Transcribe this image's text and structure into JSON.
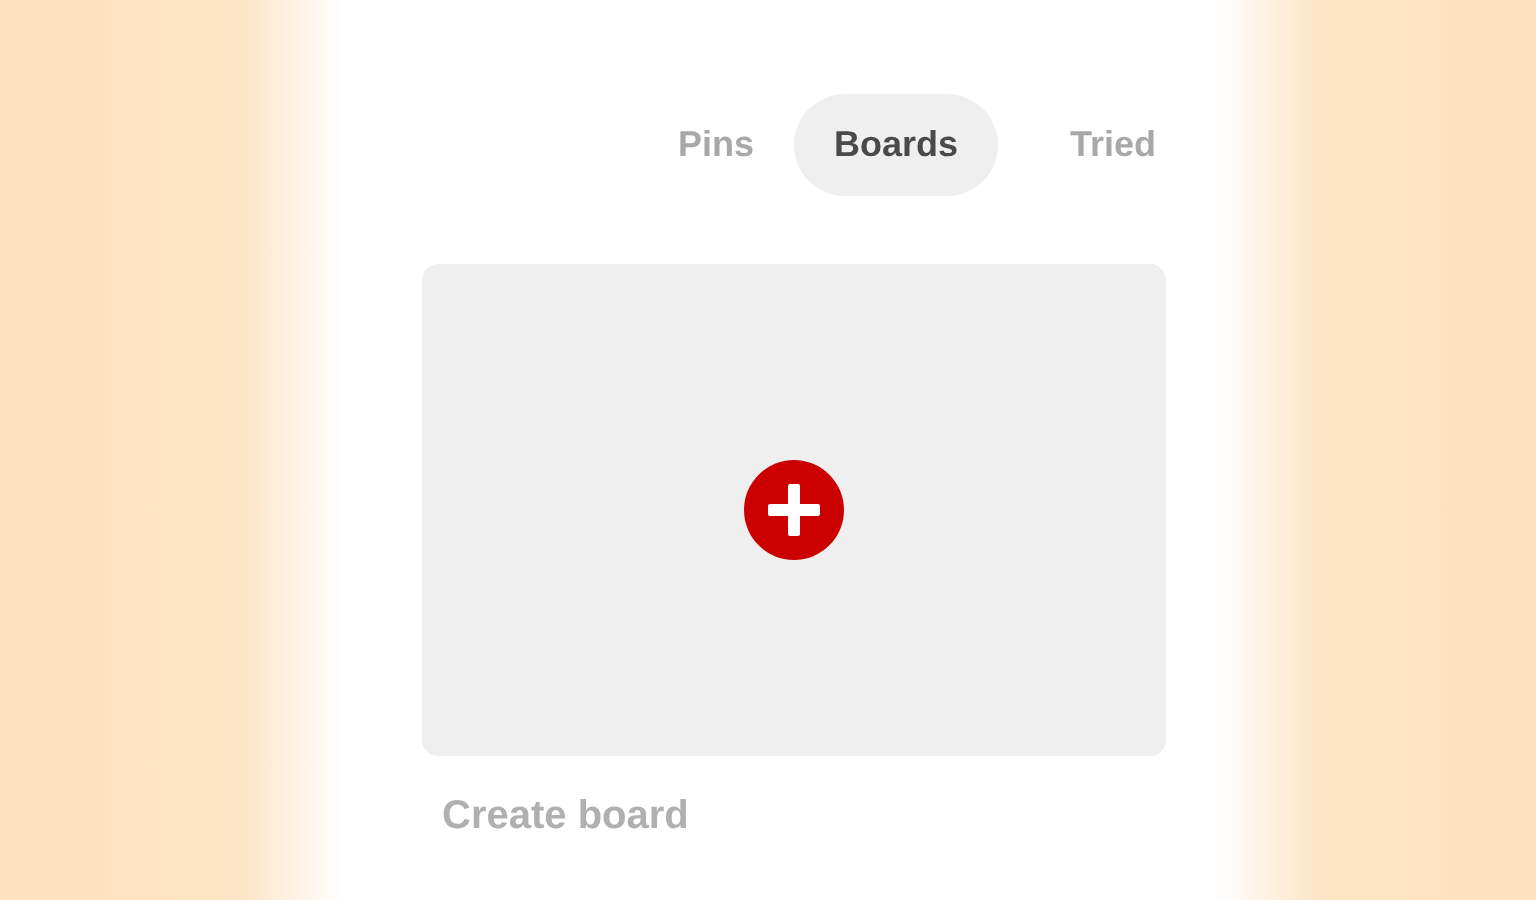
{
  "tabs": [
    {
      "label": "Pins",
      "selected": false
    },
    {
      "label": "Boards",
      "selected": true
    },
    {
      "label": "Tried",
      "selected": false
    }
  ],
  "create_board": {
    "label": "Create board"
  }
}
